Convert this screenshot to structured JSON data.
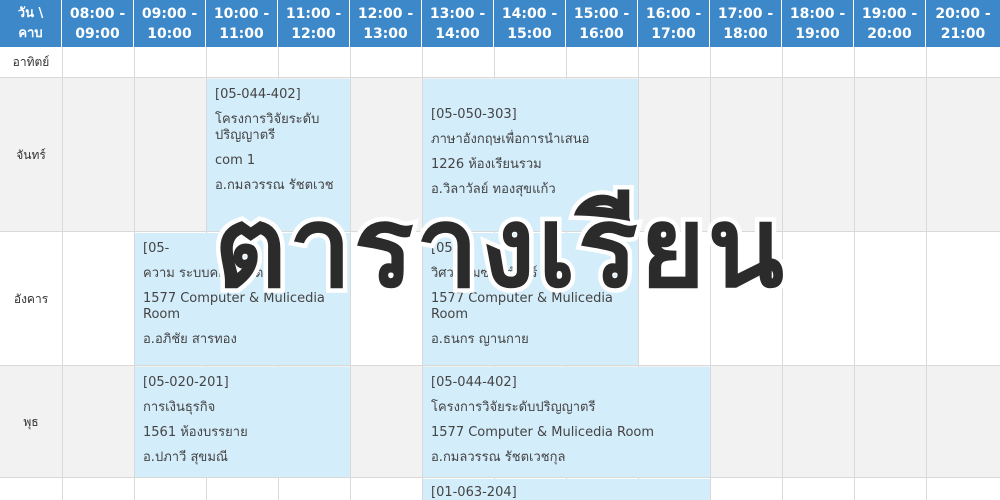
{
  "header": {
    "corner_line1": "วัน \\",
    "corner_line2": "คาบ",
    "slots": [
      {
        "start": "08:00 -",
        "end": "09:00"
      },
      {
        "start": "09:00 -",
        "end": "10:00"
      },
      {
        "start": "10:00 -",
        "end": "11:00"
      },
      {
        "start": "11:00 -",
        "end": "12:00"
      },
      {
        "start": "12:00 -",
        "end": "13:00"
      },
      {
        "start": "13:00 -",
        "end": "14:00"
      },
      {
        "start": "14:00 -",
        "end": "15:00"
      },
      {
        "start": "15:00 -",
        "end": "16:00"
      },
      {
        "start": "16:00 -",
        "end": "17:00"
      },
      {
        "start": "17:00 -",
        "end": "18:00"
      },
      {
        "start": "18:00 -",
        "end": "19:00"
      },
      {
        "start": "19:00 -",
        "end": "20:00"
      },
      {
        "start": "20:00 -",
        "end": "21:00"
      }
    ]
  },
  "days": [
    "อาทิตย์",
    "จันทร์",
    "อังคาร",
    "พุธ"
  ],
  "courses": {
    "mon_1": {
      "code": "[05-044-402]",
      "name": "โครงการวิจัยระดับปริญญาตรี",
      "room": "com 1",
      "teacher": "อ.กมลวรรณ รัชตเวช"
    },
    "mon_2": {
      "code": "[05-050-303]",
      "name": "ภาษาอังกฤษเพื่อการนำเสนอ",
      "room": "1226 ห้องเรียนรวม",
      "teacher": "อ.วิลาวัลย์ ทองสุขแก้ว"
    },
    "tue_1": {
      "code": "[05-",
      "name": "ความ      ระบบคอมพิวเตอ",
      "room": "1577 Computer & Mulicedia Room",
      "teacher": "อ.อภิชัย สารทอง"
    },
    "tue_2": {
      "code": "[05-        4]",
      "name": "วิศว      รรมซอฟต์แวร์",
      "room": "1577 Computer & Mulicedia Room",
      "teacher": "อ.ธนกร ญานกาย"
    },
    "wed_1": {
      "code": "[05-020-201]",
      "name": "การเงินธุรกิจ",
      "room": "1561 ห้องบรรยาย",
      "teacher": "อ.ปภาวี สุขมณี"
    },
    "wed_2": {
      "code": "[05-044-402]",
      "name": "โครงการวิจัยระดับปริญญาตรี",
      "room": "1577 Computer & Mulicedia Room",
      "teacher": "อ.กมลวรรณ รัชตเวชกุล"
    },
    "thu_2": {
      "code": "[01-063-204]"
    }
  },
  "overlay_title": "ตารางเรียน",
  "colors": {
    "header": "#3d88c9",
    "course": "#d4edfb",
    "weekend_row": "#ffffff",
    "row_alt": "#f2f2f2"
  }
}
